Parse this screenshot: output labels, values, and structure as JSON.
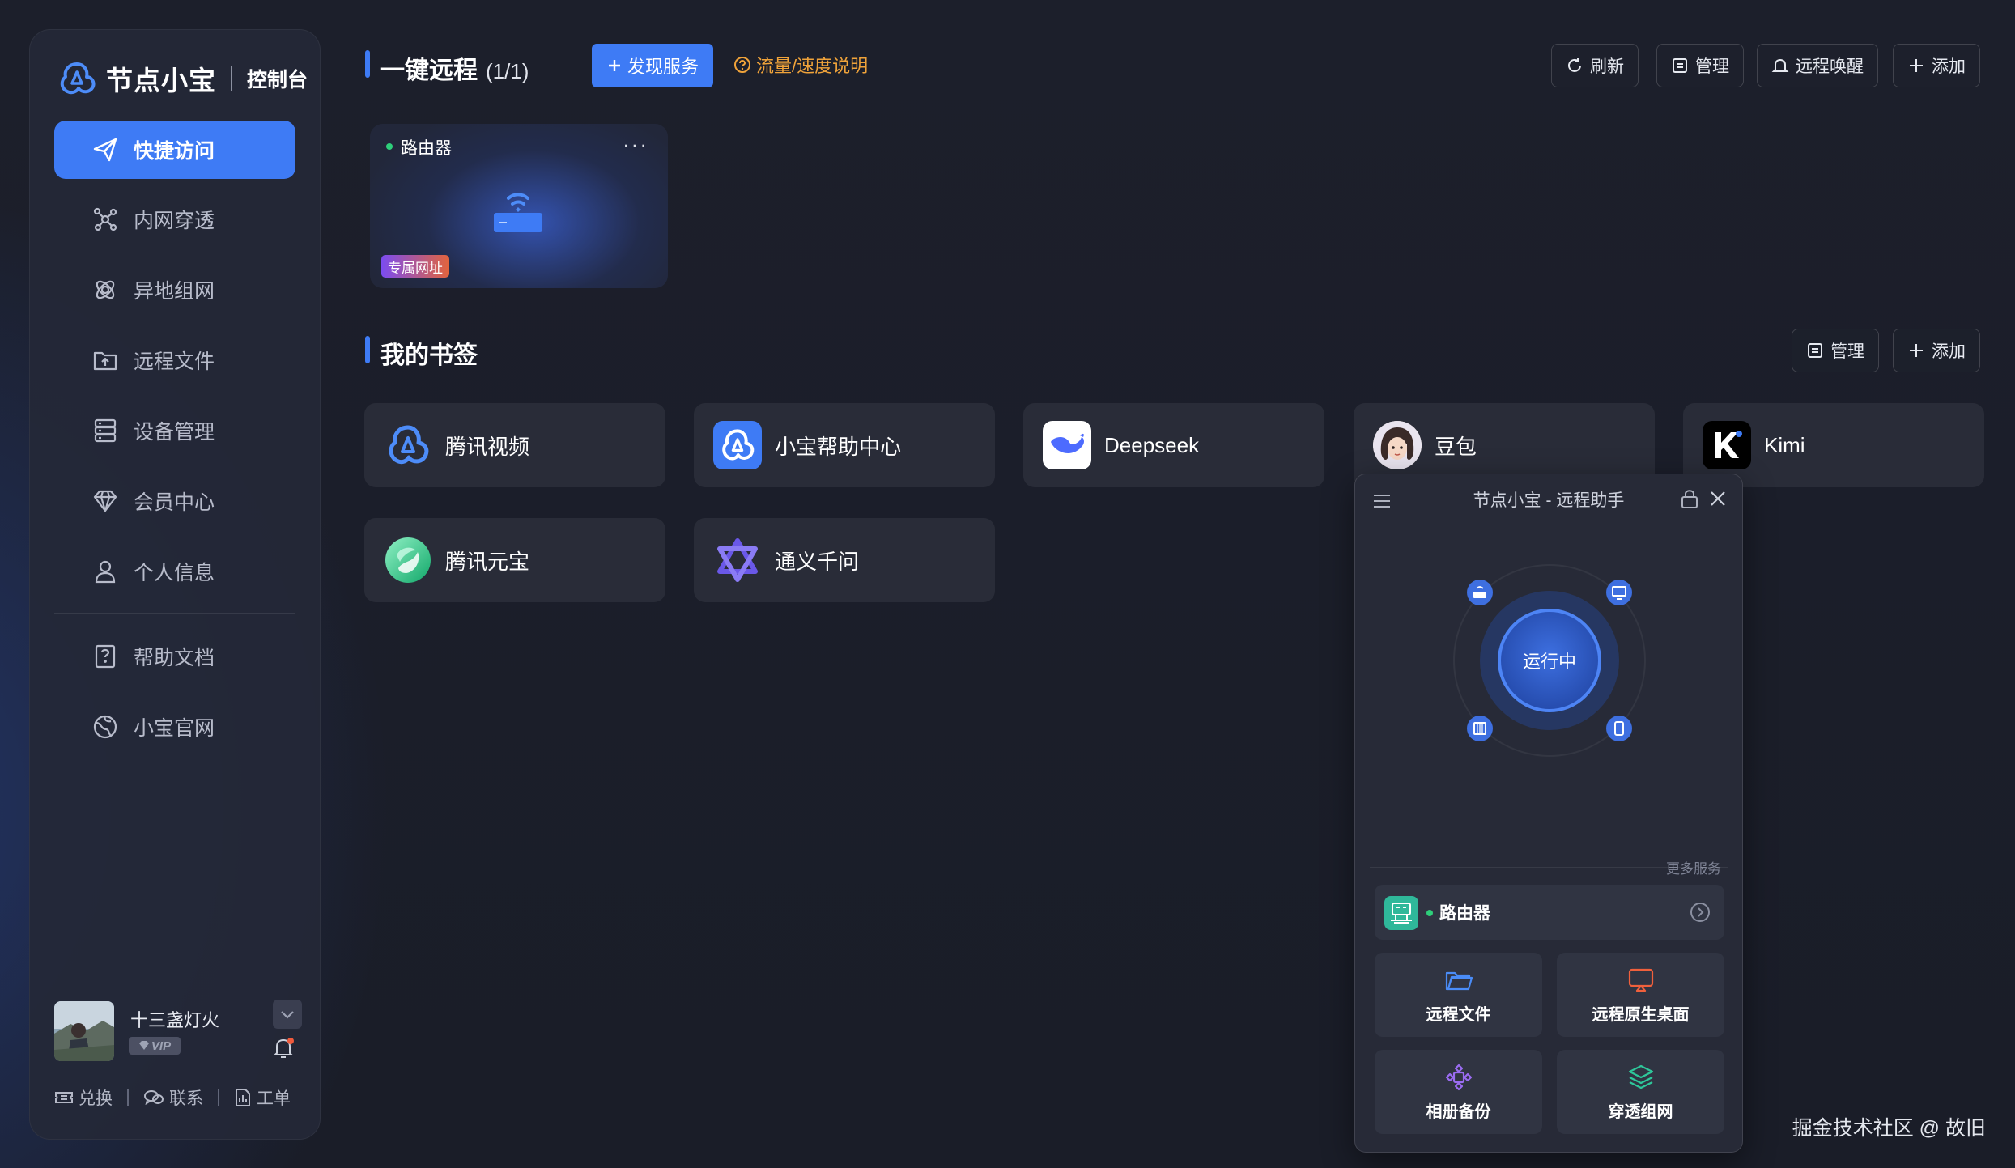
{
  "brand": {
    "name": "节点小宝",
    "subtitle": "控制台"
  },
  "nav": {
    "items": [
      {
        "label": "快捷访问",
        "icon": "send-icon",
        "active": true
      },
      {
        "label": "内网穿透",
        "icon": "network-icon"
      },
      {
        "label": "异地组网",
        "icon": "orbit-icon"
      },
      {
        "label": "远程文件",
        "icon": "upload-folder-icon"
      },
      {
        "label": "设备管理",
        "icon": "server-icon"
      },
      {
        "label": "会员中心",
        "icon": "diamond-icon"
      },
      {
        "label": "个人信息",
        "icon": "user-icon"
      }
    ],
    "secondary": [
      {
        "label": "帮助文档",
        "icon": "help-doc-icon"
      },
      {
        "label": "小宝官网",
        "icon": "globe-icon"
      }
    ]
  },
  "user": {
    "name": "十三盏灯火",
    "badge": "VIP"
  },
  "footer_links": [
    {
      "label": "兑换",
      "icon": "ticket-icon"
    },
    {
      "label": "联系",
      "icon": "chat-icon"
    },
    {
      "label": "工单",
      "icon": "document-icon"
    }
  ],
  "remote": {
    "title": "一键远程",
    "count": "(1/1)",
    "discover_button": "发现服务",
    "traffic_link": "流量/速度说明",
    "actions": {
      "refresh": "刷新",
      "manage": "管理",
      "wake": "远程唤醒",
      "add": "添加"
    },
    "device": {
      "name": "路由器",
      "tag": "专属网址",
      "status": "online"
    }
  },
  "bookmarks": {
    "title": "我的书签",
    "actions": {
      "manage": "管理",
      "add": "添加"
    },
    "items": [
      {
        "label": "腾讯视频"
      },
      {
        "label": "小宝帮助中心"
      },
      {
        "label": "Deepseek"
      },
      {
        "label": "豆包"
      },
      {
        "label": "Kimi"
      },
      {
        "label": "腾讯元宝"
      },
      {
        "label": "通义千问"
      }
    ]
  },
  "assistant": {
    "title": "节点小宝 - 远程助手",
    "status": "运行中",
    "more_services": "更多服务",
    "device": "路由器",
    "tiles": [
      {
        "label": "远程文件",
        "icon": "folder-icon",
        "color": "#4a8cf7"
      },
      {
        "label": "远程原生桌面",
        "icon": "monitor-icon",
        "color": "#f0603c"
      },
      {
        "label": "相册备份",
        "icon": "photo-sync-icon",
        "color": "#9b6cf2"
      },
      {
        "label": "穿透组网",
        "icon": "layers-icon",
        "color": "#2ec79a"
      }
    ]
  },
  "watermark": "掘金技术社区 @ 故旧",
  "colors": {
    "accent": "#3e7bf5",
    "warning": "#f0a33a",
    "online": "#2ecf7a"
  }
}
